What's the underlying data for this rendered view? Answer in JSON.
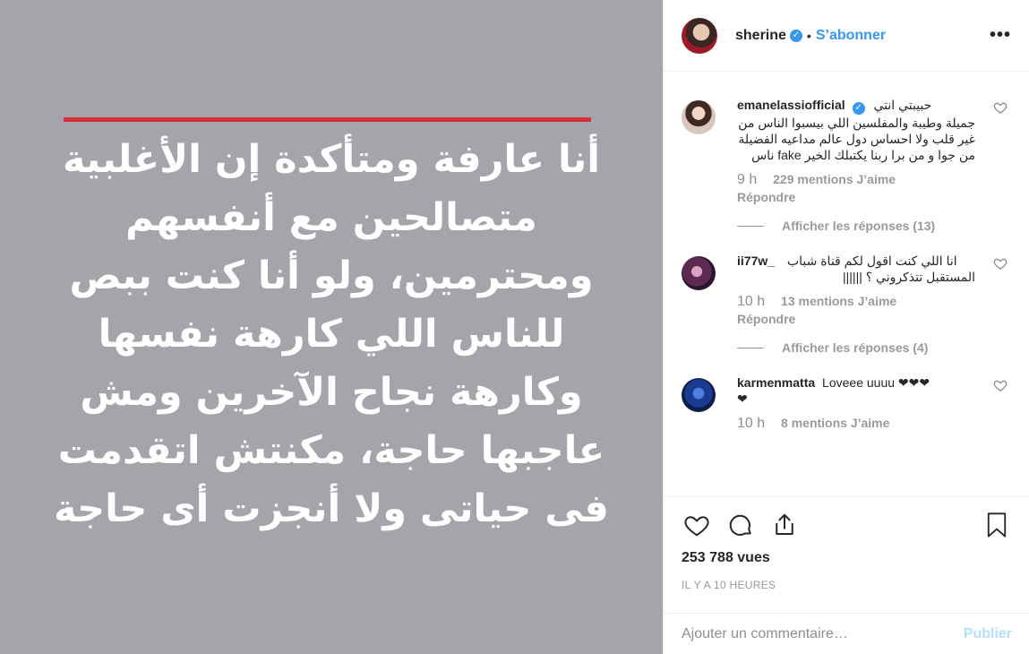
{
  "post": {
    "quote_lines": [
      "أنا عارفة ومتأكدة إن الأغلبية",
      "متصالحين مع أنفسهم",
      "ومحترمين، ولو أنا كنت ببص",
      "للناس اللي كارهة نفسها",
      "وكارهة نجاح الآخرين ومش",
      "عاجبها حاجة، مكنتش اتقدمت",
      "فى حياتى ولا أنجزت أى حاجة"
    ]
  },
  "header": {
    "username": "sherine",
    "dot": "•",
    "follow_label": "S’abonner",
    "more_label": "•••"
  },
  "comments": [
    {
      "username": "emanelassiofficial",
      "text_lines": [
        "حبيبتي انتي",
        "جميلة وطيبة والمفلسين اللي بيسبوا الناس من",
        "غير قلب ولا احساس دول عالم مداعيه الفضيلة",
        "من جوا و من برا ربنا يكتبلك الخير fake ناس"
      ],
      "time": "9 h",
      "likes": "229 mentions J’aime",
      "reply": "Répondre",
      "show_replies": "Afficher les réponses (13)"
    },
    {
      "username": "ii77w_",
      "text_lines": [
        "انا اللي كنت اقول لكم قناة شباب",
        "المستقبل تتذكروني ؟ ||||||"
      ],
      "time": "10 h",
      "likes": "13 mentions J’aime",
      "reply": "Répondre",
      "show_replies": "Afficher les réponses (4)"
    },
    {
      "username": "karmenmatta",
      "text_lines": [
        "Loveee uuuu ❤❤❤",
        "❤"
      ],
      "time": "10 h",
      "likes": "8 mentions J’aime"
    }
  ],
  "stats": {
    "views": "253 788 vues",
    "posted": "IL Y A 10 HEURES"
  },
  "add_comment": {
    "placeholder": "Ajouter un commentaire…",
    "publish_label": "Publier"
  },
  "colors": {
    "accent": "#3897f0",
    "media_bg": "#a5a4aa",
    "red_line": "#d3343c"
  }
}
